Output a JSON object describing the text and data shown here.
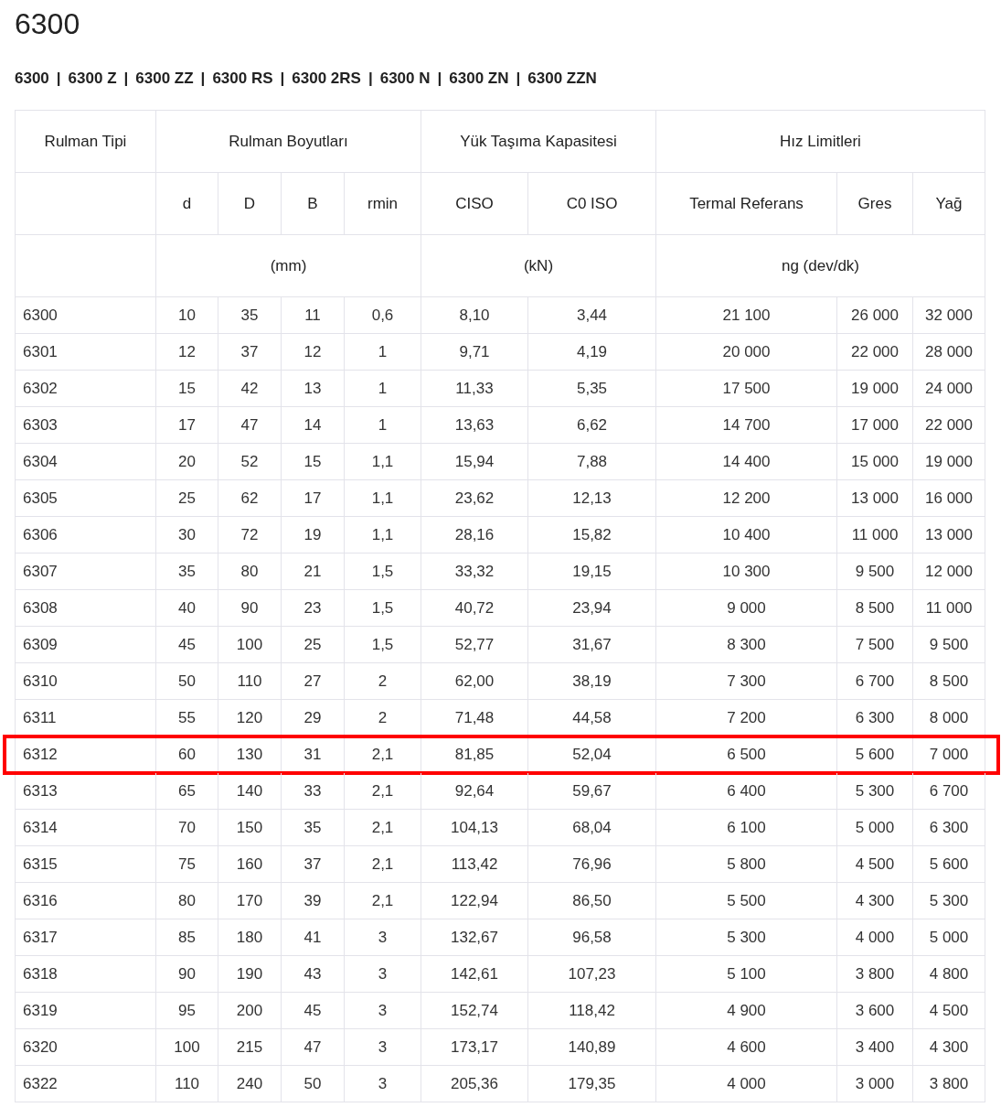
{
  "title": "6300",
  "variants": [
    "6300",
    "6300 Z",
    "6300 ZZ",
    "6300 RS",
    "6300 2RS",
    "6300 N",
    "6300 ZN",
    "6300 ZZN"
  ],
  "separator": "|",
  "table": {
    "groups": [
      "Rulman Tipi",
      "Rulman Boyutları",
      "Yük Taşıma Kapasitesi",
      "Hız Limitleri"
    ],
    "columns": [
      "",
      "d",
      "D",
      "B",
      "rmin",
      "CISO",
      "C0 ISO",
      "Termal Referans",
      "Gres",
      "Yağ"
    ],
    "units": [
      "(mm)",
      "(kN)",
      "ng (dev/dk)"
    ],
    "rows": [
      {
        "cells": [
          "6300",
          "10",
          "35",
          "11",
          "0,6",
          "8,10",
          "3,44",
          "21 100",
          "26 000",
          "32 000"
        ],
        "highlighted": false
      },
      {
        "cells": [
          "6301",
          "12",
          "37",
          "12",
          "1",
          "9,71",
          "4,19",
          "20 000",
          "22 000",
          "28 000"
        ],
        "highlighted": false
      },
      {
        "cells": [
          "6302",
          "15",
          "42",
          "13",
          "1",
          "11,33",
          "5,35",
          "17 500",
          "19 000",
          "24 000"
        ],
        "highlighted": false
      },
      {
        "cells": [
          "6303",
          "17",
          "47",
          "14",
          "1",
          "13,63",
          "6,62",
          "14 700",
          "17 000",
          "22 000"
        ],
        "highlighted": false
      },
      {
        "cells": [
          "6304",
          "20",
          "52",
          "15",
          "1,1",
          "15,94",
          "7,88",
          "14 400",
          "15 000",
          "19 000"
        ],
        "highlighted": false
      },
      {
        "cells": [
          "6305",
          "25",
          "62",
          "17",
          "1,1",
          "23,62",
          "12,13",
          "12 200",
          "13 000",
          "16 000"
        ],
        "highlighted": false
      },
      {
        "cells": [
          "6306",
          "30",
          "72",
          "19",
          "1,1",
          "28,16",
          "15,82",
          "10 400",
          "11 000",
          "13 000"
        ],
        "highlighted": false
      },
      {
        "cells": [
          "6307",
          "35",
          "80",
          "21",
          "1,5",
          "33,32",
          "19,15",
          "10 300",
          "9 500",
          "12 000"
        ],
        "highlighted": false
      },
      {
        "cells": [
          "6308",
          "40",
          "90",
          "23",
          "1,5",
          "40,72",
          "23,94",
          "9 000",
          "8 500",
          "11 000"
        ],
        "highlighted": false
      },
      {
        "cells": [
          "6309",
          "45",
          "100",
          "25",
          "1,5",
          "52,77",
          "31,67",
          "8 300",
          "7 500",
          "9 500"
        ],
        "highlighted": false
      },
      {
        "cells": [
          "6310",
          "50",
          "110",
          "27",
          "2",
          "62,00",
          "38,19",
          "7 300",
          "6 700",
          "8 500"
        ],
        "highlighted": false
      },
      {
        "cells": [
          "6311",
          "55",
          "120",
          "29",
          "2",
          "71,48",
          "44,58",
          "7 200",
          "6 300",
          "8 000"
        ],
        "highlighted": false
      },
      {
        "cells": [
          "6312",
          "60",
          "130",
          "31",
          "2,1",
          "81,85",
          "52,04",
          "6 500",
          "5 600",
          "7 000"
        ],
        "highlighted": true
      },
      {
        "cells": [
          "6313",
          "65",
          "140",
          "33",
          "2,1",
          "92,64",
          "59,67",
          "6 400",
          "5 300",
          "6 700"
        ],
        "highlighted": false
      },
      {
        "cells": [
          "6314",
          "70",
          "150",
          "35",
          "2,1",
          "104,13",
          "68,04",
          "6 100",
          "5 000",
          "6 300"
        ],
        "highlighted": false
      },
      {
        "cells": [
          "6315",
          "75",
          "160",
          "37",
          "2,1",
          "113,42",
          "76,96",
          "5 800",
          "4 500",
          "5 600"
        ],
        "highlighted": false
      },
      {
        "cells": [
          "6316",
          "80",
          "170",
          "39",
          "2,1",
          "122,94",
          "86,50",
          "5 500",
          "4 300",
          "5 300"
        ],
        "highlighted": false
      },
      {
        "cells": [
          "6317",
          "85",
          "180",
          "41",
          "3",
          "132,67",
          "96,58",
          "5 300",
          "4 000",
          "5 000"
        ],
        "highlighted": false
      },
      {
        "cells": [
          "6318",
          "90",
          "190",
          "43",
          "3",
          "142,61",
          "107,23",
          "5 100",
          "3 800",
          "4 800"
        ],
        "highlighted": false
      },
      {
        "cells": [
          "6319",
          "95",
          "200",
          "45",
          "3",
          "152,74",
          "118,42",
          "4 900",
          "3 600",
          "4 500"
        ],
        "highlighted": false
      },
      {
        "cells": [
          "6320",
          "100",
          "215",
          "47",
          "3",
          "173,17",
          "140,89",
          "4 600",
          "3 400",
          "4 300"
        ],
        "highlighted": false
      },
      {
        "cells": [
          "6322",
          "110",
          "240",
          "50",
          "3",
          "205,36",
          "179,35",
          "4 000",
          "3 000",
          "3 800"
        ],
        "highlighted": false
      }
    ]
  }
}
